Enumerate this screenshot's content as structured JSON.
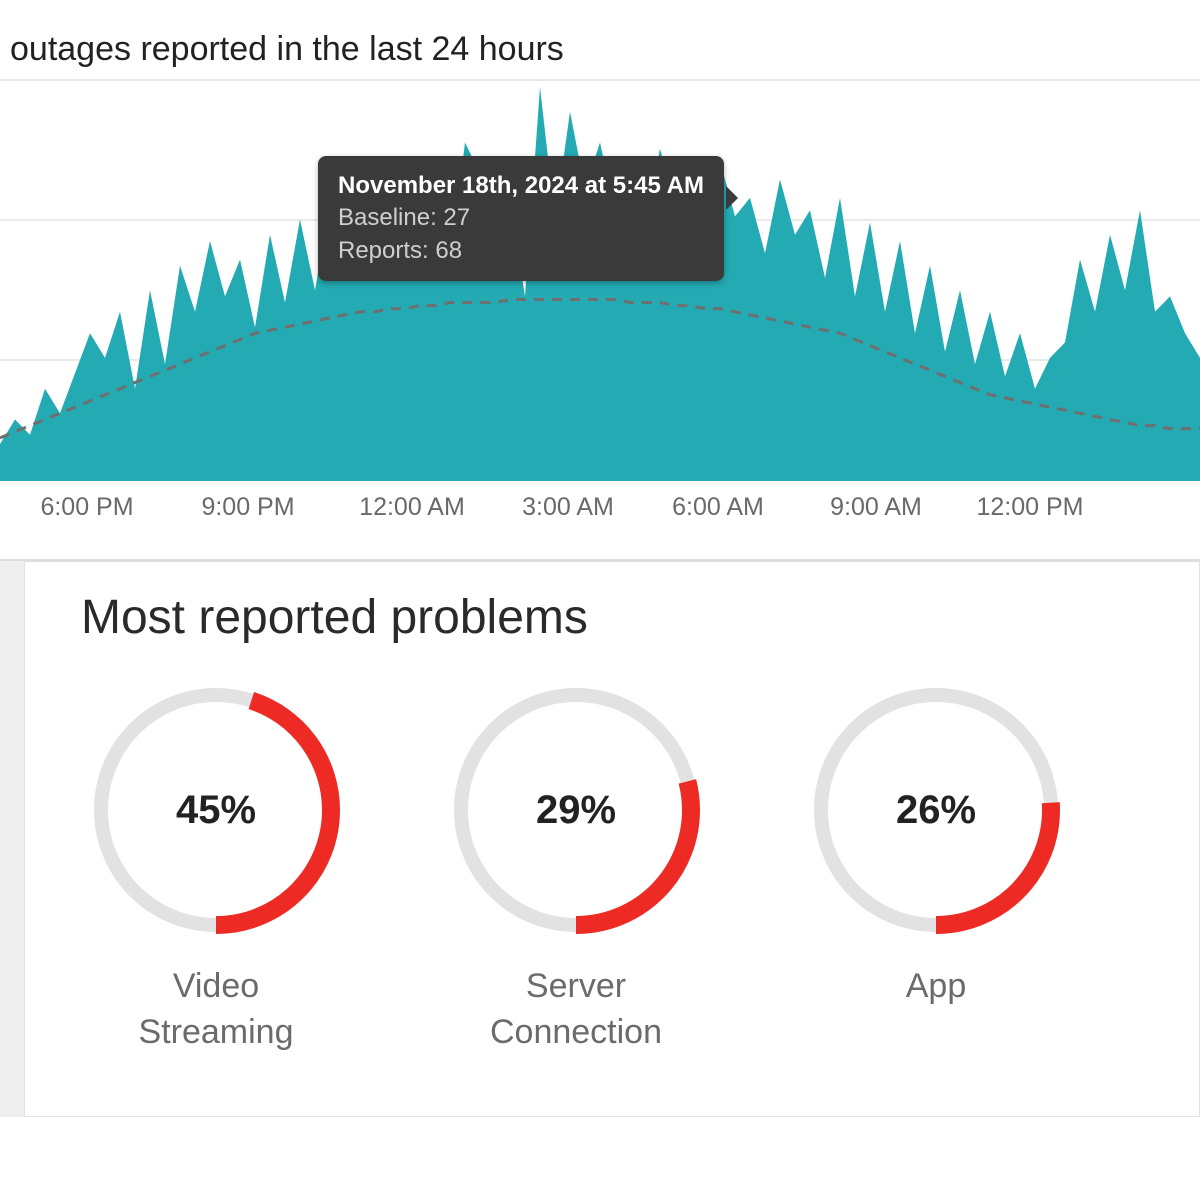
{
  "title": "outages reported in the last 24 hours",
  "chart_data": {
    "type": "area",
    "xlabel": "",
    "ylabel": "",
    "ylim": [
      0,
      130
    ],
    "x_ticks": [
      "6:00 PM",
      "9:00 PM",
      "12:00 AM",
      "3:00 AM",
      "6:00 AM",
      "9:00 AM",
      "12:00 PM"
    ],
    "series": [
      {
        "name": "Reports",
        "values": [
          12,
          20,
          15,
          30,
          22,
          35,
          48,
          40,
          55,
          30,
          62,
          38,
          70,
          55,
          78,
          60,
          72,
          50,
          80,
          58,
          85,
          62,
          90,
          70,
          95,
          75,
          100,
          80,
          105,
          85,
          70,
          110,
          100,
          72,
          90,
          60,
          128,
          85,
          120,
          95,
          110,
          88,
          100,
          82,
          108,
          90,
          95,
          78,
          104,
          86,
          92,
          74,
          98,
          80,
          88,
          66,
          92,
          60,
          84,
          55,
          78,
          48,
          70,
          42,
          62,
          38,
          55,
          34,
          48,
          30,
          40,
          45,
          72,
          55,
          80,
          62,
          88,
          55,
          60,
          48,
          40
        ]
      },
      {
        "name": "Baseline",
        "values": [
          14,
          16,
          18,
          20,
          22,
          24,
          26,
          28,
          30,
          32,
          34,
          36,
          38,
          40,
          42,
          44,
          46,
          48,
          49,
          50,
          51,
          52,
          53,
          54,
          55,
          55,
          56,
          56,
          57,
          57,
          58,
          58,
          58,
          58,
          59,
          59,
          59,
          59,
          59,
          59,
          59,
          59,
          58,
          58,
          58,
          57,
          57,
          56,
          56,
          55,
          54,
          53,
          52,
          51,
          50,
          49,
          48,
          46,
          44,
          42,
          40,
          38,
          36,
          34,
          32,
          30,
          28,
          27,
          26,
          25,
          24,
          23,
          22,
          21,
          20,
          19,
          18,
          18,
          17,
          17,
          17
        ]
      }
    ],
    "tooltip": {
      "title": "November 18th, 2024 at 5:45 AM",
      "baseline": 27,
      "reports": 68
    }
  },
  "problems": {
    "title": "Most reported problems",
    "items": [
      {
        "label": "Video Streaming",
        "percent": 45
      },
      {
        "label": "Server Connection",
        "percent": 29
      },
      {
        "label": "App",
        "percent": 26
      }
    ]
  },
  "labels": {
    "baseline_prefix": "Baseline: ",
    "reports_prefix": "Reports: "
  }
}
